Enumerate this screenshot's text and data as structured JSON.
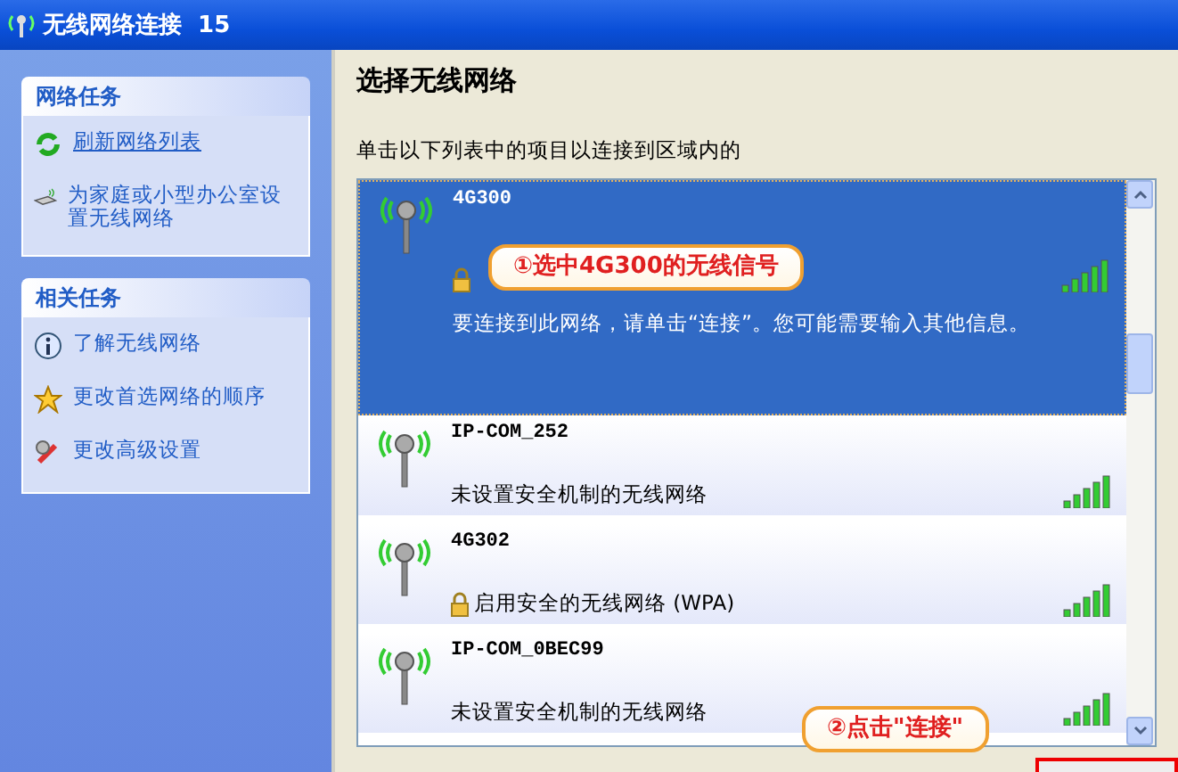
{
  "window": {
    "title": "无线网络连接  15"
  },
  "sidebar": {
    "panels": [
      {
        "title": "网络任务",
        "items": [
          {
            "label": "刷新网络列表",
            "kind": "refresh",
            "underlined": true
          },
          {
            "label": "为家庭或小型办公室设置无线网络",
            "kind": "setup",
            "underlined": false
          }
        ]
      },
      {
        "title": "相关任务",
        "items": [
          {
            "label": "了解无线网络",
            "kind": "info",
            "underlined": false
          },
          {
            "label": "更改首选网络的顺序",
            "kind": "star",
            "underlined": false
          },
          {
            "label": "更改高级设置",
            "kind": "tools",
            "underlined": false
          }
        ]
      }
    ]
  },
  "main": {
    "heading": "选择无线网络",
    "instruction": "单击以下列表中的项目以连接到区域内的",
    "networks": [
      {
        "name": "4G300",
        "selected": true,
        "secure": true,
        "message": "要连接到此网络，请单击“连接”。您可能需要输入其他信息。"
      },
      {
        "name": "IP-COM_252",
        "selected": false,
        "secure": false,
        "security": "未设置安全机制的无线网络"
      },
      {
        "name": "4G302",
        "selected": false,
        "secure": true,
        "security": "启用安全的无线网络 (WPA)"
      },
      {
        "name": "IP-COM_0BEC99",
        "selected": false,
        "secure": false,
        "security": "未设置安全机制的无线网络"
      }
    ]
  },
  "annotations": [
    "①选中4G300的无线信号",
    "②点击\"连接\""
  ]
}
